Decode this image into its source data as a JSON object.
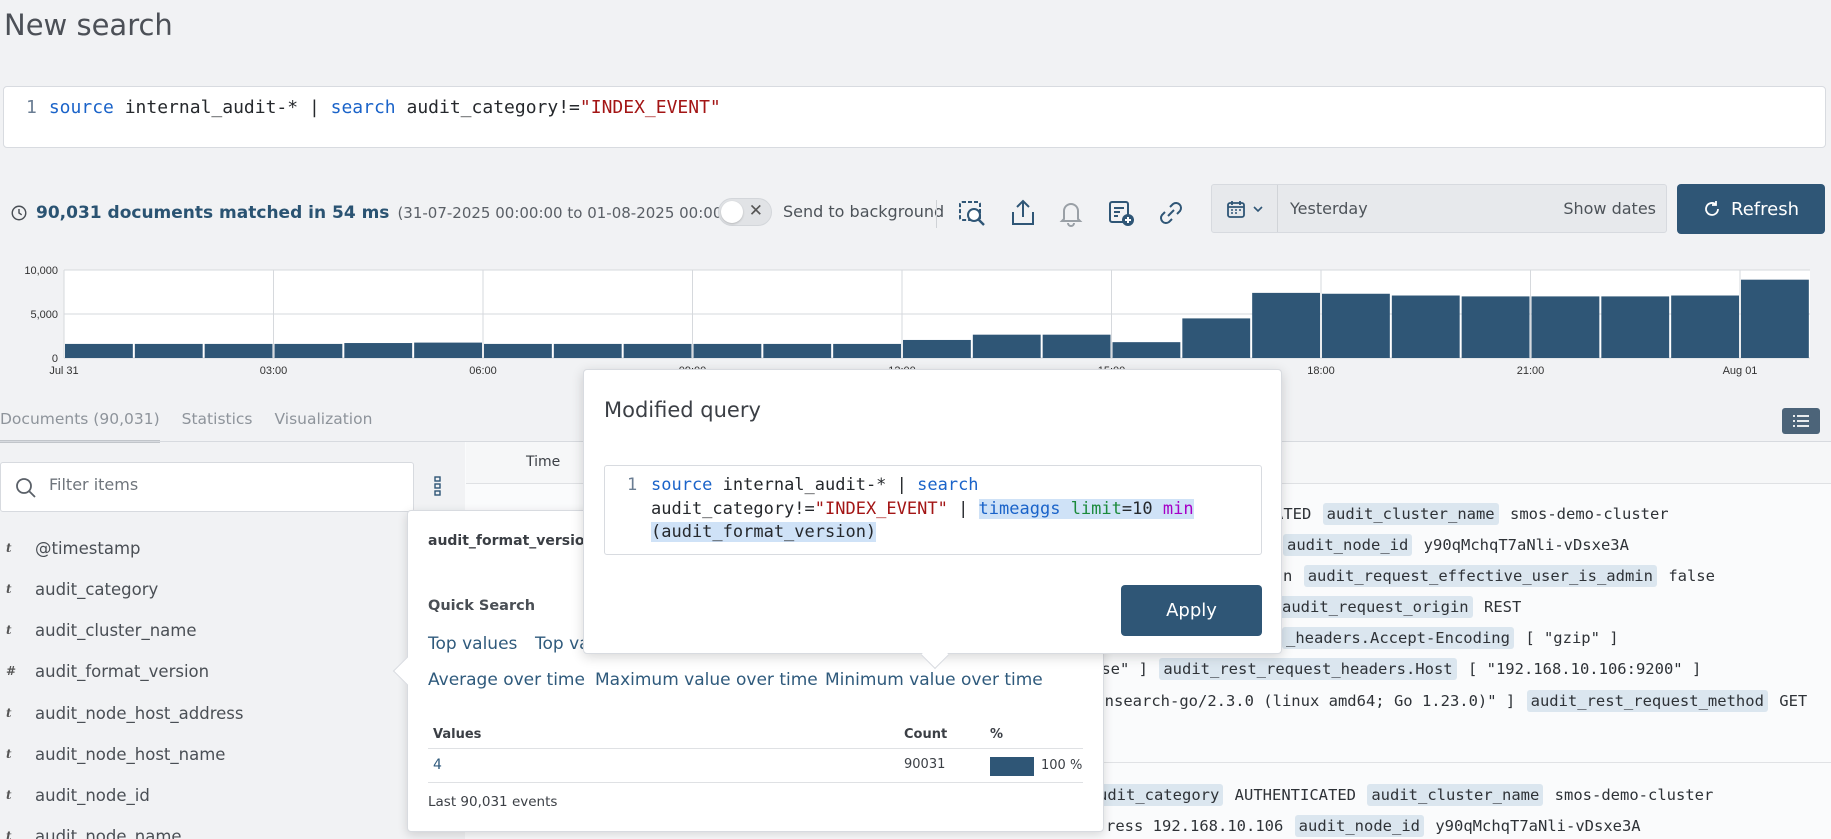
{
  "page": {
    "title": "New search"
  },
  "query": {
    "line_number": "1",
    "kw_source": "source",
    "index": " internal_audit-* | ",
    "kw_search": "search",
    "condition": " audit_category!=",
    "value": "\"INDEX_EVENT\""
  },
  "status": {
    "count_text": "90,031 documents matched in 54 ms",
    "range_text": "(31-07-2025 00:00:00 to 01-08-2025 00:00:00)",
    "send_background": "Send to background"
  },
  "toolbar": {
    "icons": [
      "search-inspect-icon",
      "share-icon",
      "bell-icon",
      "add-report-icon",
      "link-icon"
    ]
  },
  "dates": {
    "preset": "Yesterday",
    "show_dates": "Show dates"
  },
  "refresh_label": "Refresh",
  "chart_data": {
    "type": "bar",
    "x_tick_labels": [
      "Jul 31",
      "03:00",
      "06:00",
      "09:00",
      "12:00",
      "15:00",
      "18:00",
      "21:00",
      "Aug 01"
    ],
    "y_tick_labels": [
      "10,000",
      "5,000",
      "0"
    ],
    "ylim": [
      0,
      10000
    ],
    "bin_hours": 1,
    "values": [
      1600,
      1600,
      1600,
      1600,
      1700,
      1750,
      1600,
      1600,
      1600,
      1600,
      1600,
      1600,
      2050,
      2650,
      2650,
      1800,
      4500,
      7400,
      7300,
      7100,
      7000,
      7000,
      7000,
      7100,
      8900
    ],
    "grid": true,
    "color": "#2f5676"
  },
  "tabs": [
    "Documents (90,031)",
    "Statistics",
    "Visualization"
  ],
  "filter_placeholder": "Filter items",
  "fields": [
    {
      "type": "t",
      "name": "@timestamp"
    },
    {
      "type": "t",
      "name": "audit_category"
    },
    {
      "type": "t",
      "name": "audit_cluster_name"
    },
    {
      "type": "#",
      "name": "audit_format_version"
    },
    {
      "type": "t",
      "name": "audit_node_host_address"
    },
    {
      "type": "t",
      "name": "audit_node_host_name"
    },
    {
      "type": "t",
      "name": "audit_node_id"
    },
    {
      "type": "t",
      "name": "audit_node_name"
    }
  ],
  "docs": {
    "time_header": "Time",
    "row1": [
      {
        "k": "",
        "v": "TICATED"
      },
      {
        "k": "audit_cluster_name",
        "v": "smos-demo-cluster"
      }
    ],
    "row2": [
      {
        "k": "audit_node_id",
        "v": "y90qMchqT7aNli-vDsxe3A"
      }
    ],
    "row3_prefix": "n",
    "row3": [
      {
        "k": "audit_request_effective_user_is_admin",
        "v": "false"
      }
    ],
    "row4": [
      {
        "k": "audit_request_origin",
        "v": "REST"
      }
    ],
    "row5_key": "_headers.Accept-Encoding",
    "row5_val": "[ \"gzip\" ]",
    "row6_prefix": "ose\" ]",
    "row6": [
      {
        "k": "audit_rest_request_headers.Host",
        "v": "[ \"192.168.10.106:9200\" ]"
      }
    ],
    "row7_prefix": "pensearch-go/2.3.0 (linux amd64; Go 1.23.0)\" ]",
    "row7": [
      {
        "k": "audit_rest_request_method",
        "v": "GET"
      }
    ],
    "row8": [
      {
        "k": "udit_category",
        "v": "AUTHENTICATED"
      },
      {
        "k": "audit_cluster_name",
        "v": "smos-demo-cluster"
      }
    ],
    "row9_prefix": "ress",
    "row9_ip": "192.168.10.106",
    "row9": [
      {
        "k": "audit_node_id",
        "v": "y90qMchqT7aNli-vDsxe3A"
      }
    ]
  },
  "field_popup": {
    "field_name": "audit_format_version",
    "quick_search": "Quick Search",
    "top_values": "Top values",
    "top_values_2": "Top va",
    "avg": "Average over time",
    "max": "Maximum value over time",
    "min": "Minimum value over time",
    "col_values": "Values",
    "col_count": "Count",
    "col_pct": "%",
    "value": "4",
    "value_count": "90031",
    "value_pct": "100 %",
    "value_fraction": 1.0,
    "last": "Last 90,031 events"
  },
  "modified_query": {
    "title": "Modified query",
    "line_number": "1",
    "kw_source": "source",
    "index": " internal_audit-* | ",
    "kw_search": "search",
    "condition": "audit_category!=",
    "value": "\"INDEX_EVENT\"",
    "pipe": " | ",
    "hl_timeaggs": "timeaggs",
    "hl_limit": "limit",
    "hl_eq10": "=10",
    "hl_min": "min",
    "hl_arg": "(audit_format_version)",
    "apply_label": "Apply"
  }
}
